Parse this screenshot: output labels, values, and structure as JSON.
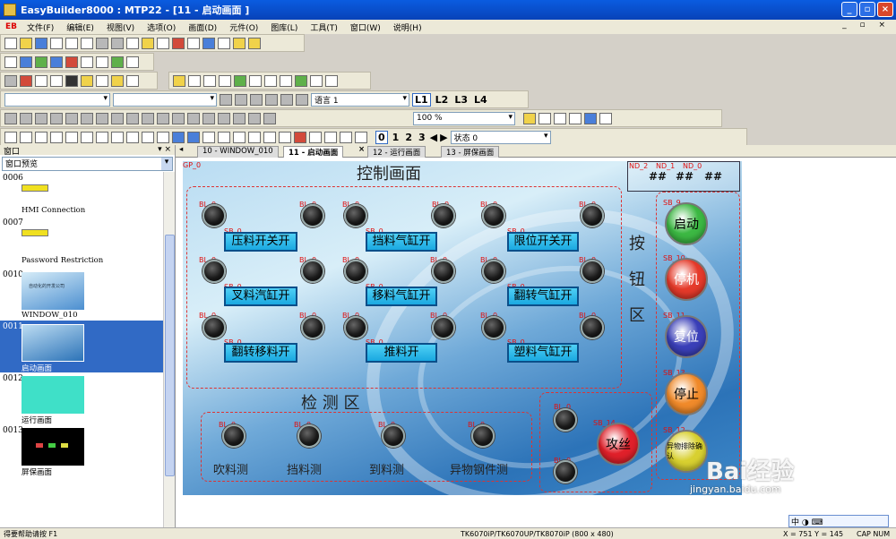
{
  "title": "EasyBuilder8000 : MTP22 - [11 - 启动画面 ]",
  "menu": {
    "logo": "EB",
    "items": [
      "文件(F)",
      "编辑(E)",
      "视图(V)",
      "选项(O)",
      "画面(D)",
      "元件(O)",
      "图库(L)",
      "工具(T)",
      "窗口(W)",
      "说明(H)"
    ],
    "mdi": "_ ▫ ×"
  },
  "toolbar": {
    "lang_label": "语言 1",
    "layers": [
      "L1",
      "L2",
      "L3",
      "L4"
    ],
    "zoom": "100 %",
    "state_label": "状态 0",
    "state_nums": [
      "0",
      "1",
      "2",
      "3"
    ]
  },
  "left_panel": {
    "header": "窗口",
    "pin": "▾ ×",
    "selector": "窗口预览",
    "items": [
      {
        "num": "0006",
        "label": "HMI Connection"
      },
      {
        "num": "0007",
        "label": "Password Restriction"
      },
      {
        "num": "0010",
        "label": "WINDOW_010",
        "thumb_text": "自动化的开发公司"
      },
      {
        "num": "0011",
        "label": "启动画面"
      },
      {
        "num": "0012",
        "label": "运行画面"
      },
      {
        "num": "0013",
        "label": "屏保画面"
      }
    ]
  },
  "tabs": [
    "10 - WINDOW_010",
    "11 - 启动画面",
    "12 - 运行画面",
    "13 - 屏保画面"
  ],
  "tab_nav": "◂",
  "tab_close": "×",
  "canvas": {
    "gp": "GP_0",
    "section_control": "控制画面",
    "section_detect": "检 测 区",
    "section_buttons": [
      "按",
      "钮",
      "区"
    ],
    "nd_tags": [
      "ND_2",
      "ND_1",
      "ND_0"
    ],
    "hash": "##",
    "lamp_tag": "BL_0",
    "push_tag": "SB_0",
    "push_buttons": [
      "压料开关开",
      "挡料气缸开",
      "限位开关开",
      "叉料汽缸开",
      "移料气缸开",
      "翻转气缸开",
      "翻转移料开",
      "推料开",
      "塑料气缸开"
    ],
    "sensors": [
      "吹料测",
      "挡料测",
      "到料测",
      "异物钢件测"
    ],
    "round_buttons": [
      {
        "label": "启动",
        "tag": "SB_9",
        "color": "#3cb843"
      },
      {
        "label": "停机",
        "tag": "SB_10",
        "color": "#e53a2a"
      },
      {
        "label": "复位",
        "tag": "SB_11",
        "color": "#3a3fb8"
      },
      {
        "label": "停止",
        "tag": "SB_13",
        "color": "#f08a2a"
      },
      {
        "label": "异物排除确认",
        "tag": "SB_12",
        "color": "#d8d030"
      }
    ],
    "tapping": {
      "label": "攻丝",
      "tag": "SB_14",
      "color": "#e0202a"
    }
  },
  "status": {
    "help": "得要帮助请按 F1",
    "model": "TK6070iP/TK6070UP/TK8070iP (800 x 480)",
    "coords": "X = 751  Y = 145",
    "caps": "CAP  NUM"
  },
  "watermark": {
    "text": "Bai经验",
    "sub": "jingyan.baidu.com"
  },
  "ime": "中 ◑ ⌨"
}
